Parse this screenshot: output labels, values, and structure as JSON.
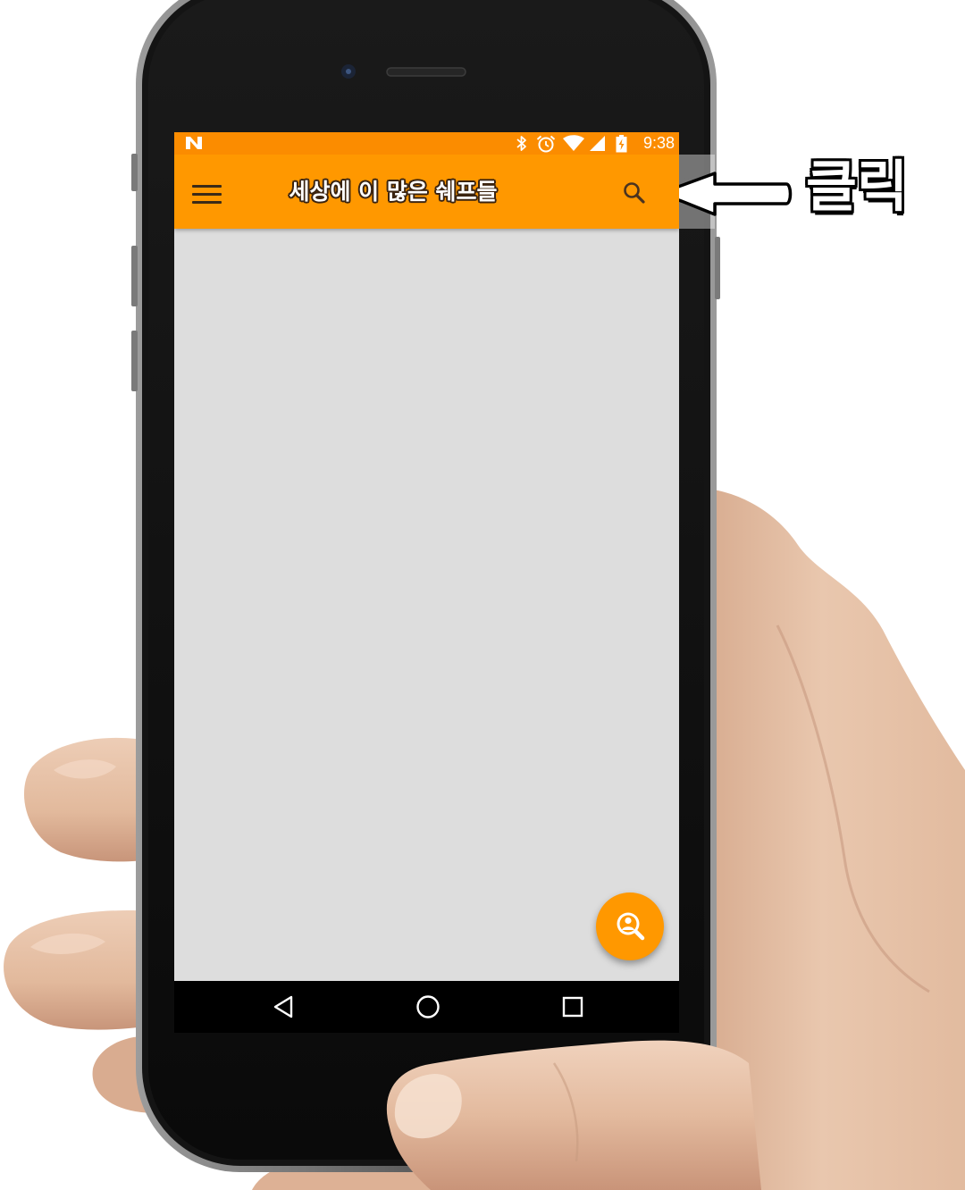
{
  "status_bar": {
    "time": "9:38",
    "icons": {
      "notification": "android-n-icon",
      "bluetooth": "bluetooth-icon",
      "alarm": "alarm-clock-icon",
      "wifi": "wifi-icon",
      "signal": "cell-signal-icon",
      "battery": "battery-charging-icon"
    }
  },
  "toolbar": {
    "title": "세상에 이 많은 쉐프들",
    "menu_icon": "hamburger-menu-icon",
    "search_icon": "search-icon"
  },
  "fab": {
    "icon": "person-search-icon"
  },
  "nav_bar": {
    "back_icon": "back-icon",
    "home_icon": "home-icon",
    "recents_icon": "recents-icon"
  },
  "annotation": {
    "label": "클릭",
    "arrow_icon": "left-arrow-icon"
  },
  "colors": {
    "primary": "#FF9800",
    "status_bar": "#FB8C00",
    "content_background": "#DDDDDD",
    "nav_bar": "#000000",
    "phone_body": "#111111",
    "skin": "#E6C1A6"
  }
}
